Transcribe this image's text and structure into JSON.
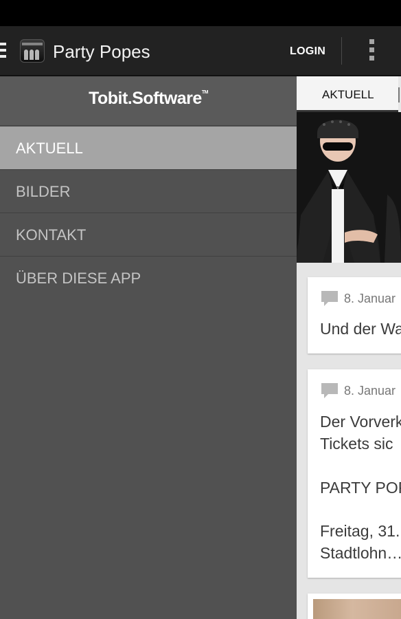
{
  "action_bar": {
    "title": "Party Popes",
    "login_label": "LOGIN",
    "icon_caption": "PARTY POPES"
  },
  "drawer": {
    "logo": "Tobit.Software",
    "logo_tm": "TM",
    "items": [
      {
        "label": "AKTUELL",
        "active": true
      },
      {
        "label": "BILDER",
        "active": false
      },
      {
        "label": "KONTAKT",
        "active": false
      },
      {
        "label": "ÜBER DIESE APP",
        "active": false
      }
    ]
  },
  "content": {
    "tab_label": "AKTUELL",
    "posts": [
      {
        "date": "8. Januar",
        "lines": [
          "Und der Wa"
        ]
      },
      {
        "date": "8. Januar",
        "lines": [
          "Der Vorverk",
          "Tickets sic",
          "",
          "PARTY POP",
          "",
          "Freitag, 31.",
          "Stadtlohn…"
        ]
      }
    ]
  },
  "colors": {
    "action_bar": "#222222",
    "drawer_bg": "#515151",
    "drawer_active": "#a5a5a5",
    "content_bg": "#e5e5e5"
  }
}
